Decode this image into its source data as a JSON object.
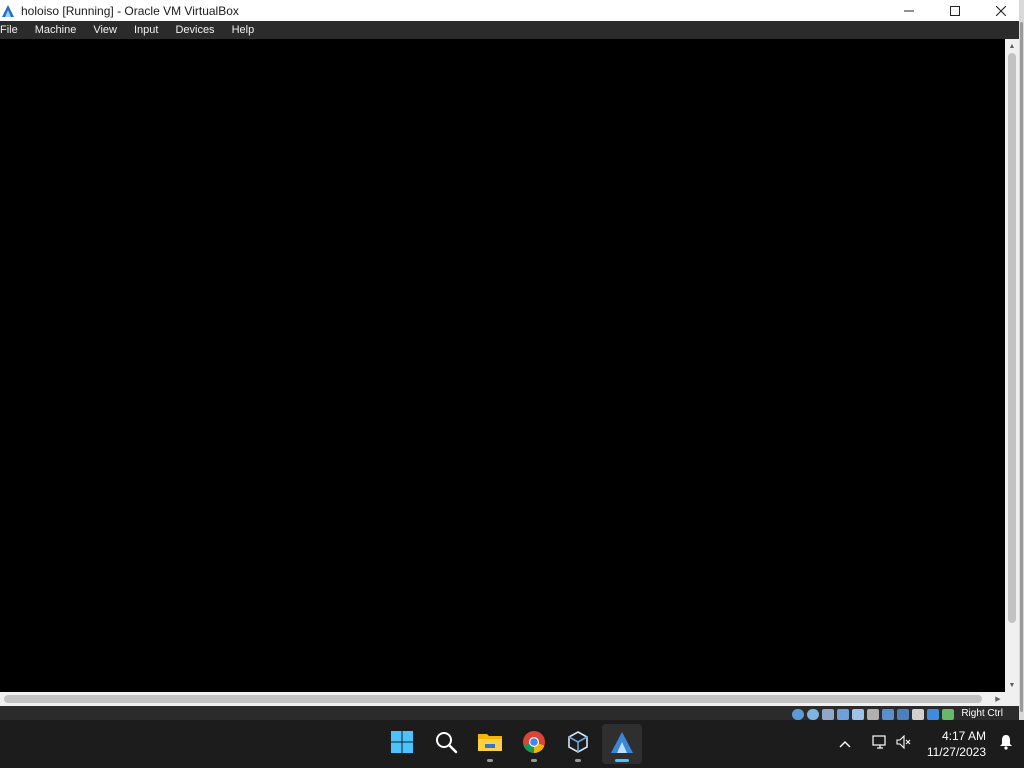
{
  "window": {
    "title": "holoiso [Running] - Oracle VM VirtualBox",
    "controls": [
      "minimize",
      "maximize",
      "close"
    ]
  },
  "menubar": {
    "items": [
      {
        "label": "File"
      },
      {
        "label": "Machine"
      },
      {
        "label": "View"
      },
      {
        "label": "Input"
      },
      {
        "label": "Devices"
      },
      {
        "label": "Help"
      }
    ]
  },
  "vm": {
    "screen_color": "#000000"
  },
  "statusbar": {
    "icons": [
      "optical-drive-icon",
      "audio-icon",
      "network-icon",
      "shared-folders-icon",
      "usb-icon",
      "display-icon",
      "recording-icon",
      "capture-icon",
      "cpu-icon",
      "mouse-integration-icon",
      "keyboard-icon"
    ],
    "host_key": "Right Ctrl"
  },
  "taskbar": {
    "apps": [
      {
        "name": "start-button-icon"
      },
      {
        "name": "search-icon"
      },
      {
        "name": "file-explorer-icon"
      },
      {
        "name": "chrome-icon"
      },
      {
        "name": "virtualbox-icon"
      },
      {
        "name": "virtualbox-vm-icon"
      }
    ],
    "tray": {
      "time": "4:17 AM",
      "date": "11/27/2023"
    }
  },
  "colors": {
    "accent": "#4cc2ff",
    "taskbar_bg": "#1c1c1c",
    "menubar_bg": "#2b2b2b"
  }
}
